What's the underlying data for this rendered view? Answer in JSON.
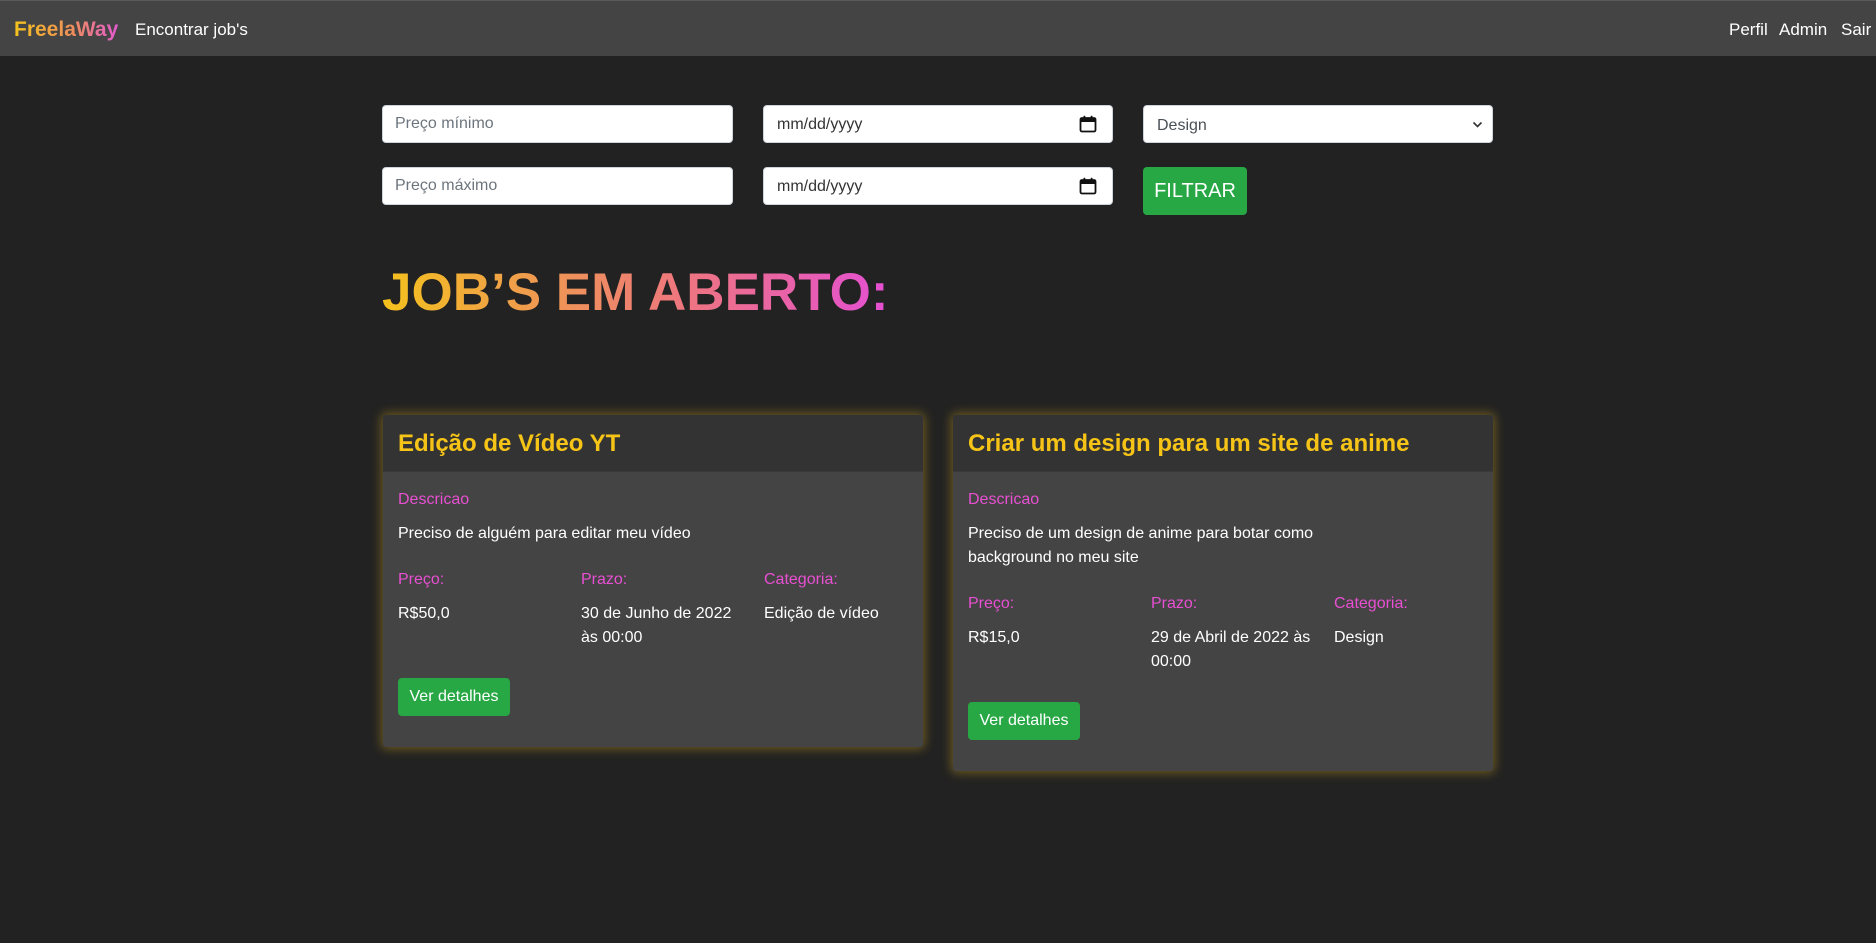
{
  "navbar": {
    "brand": "FreelaWay",
    "find_jobs": "Encontrar job's",
    "profile": "Perfil",
    "admin": "Admin",
    "logout": "Sair"
  },
  "filters": {
    "min_price_placeholder": "Preço mínimo",
    "max_price_placeholder": "Preço máximo",
    "date_start": "mm/dd/yyyy",
    "date_end": "mm/dd/yyyy",
    "category_selected": "Design",
    "filter_button": "FILTRAR"
  },
  "page_title": "JOB’S EM ABERTO:",
  "labels": {
    "description": "Descricao",
    "price": "Preço:",
    "deadline": "Prazo:",
    "category": "Categoria:",
    "details_button": "Ver detalhes"
  },
  "jobs": [
    {
      "title": "Edição de Vídeo YT",
      "description": "Preciso de alguém para editar meu vídeo",
      "price": "R$50,0",
      "deadline": "30 de Junho de 2022 às 00:00",
      "category": "Edição de vídeo"
    },
    {
      "title": "Criar um design para um site de anime",
      "description": "Preciso de um design de anime para botar como background no meu site",
      "price": "R$15,0",
      "deadline": "29 de Abril de 2022 às 00:00",
      "category": "Design"
    }
  ],
  "colors": {
    "background": "#222222",
    "navbar": "#444444",
    "card": "#444444",
    "card_header": "#333333",
    "accent_yellow": "#f6c417",
    "accent_pink": "#e84fd2",
    "button_green": "#28a745"
  }
}
